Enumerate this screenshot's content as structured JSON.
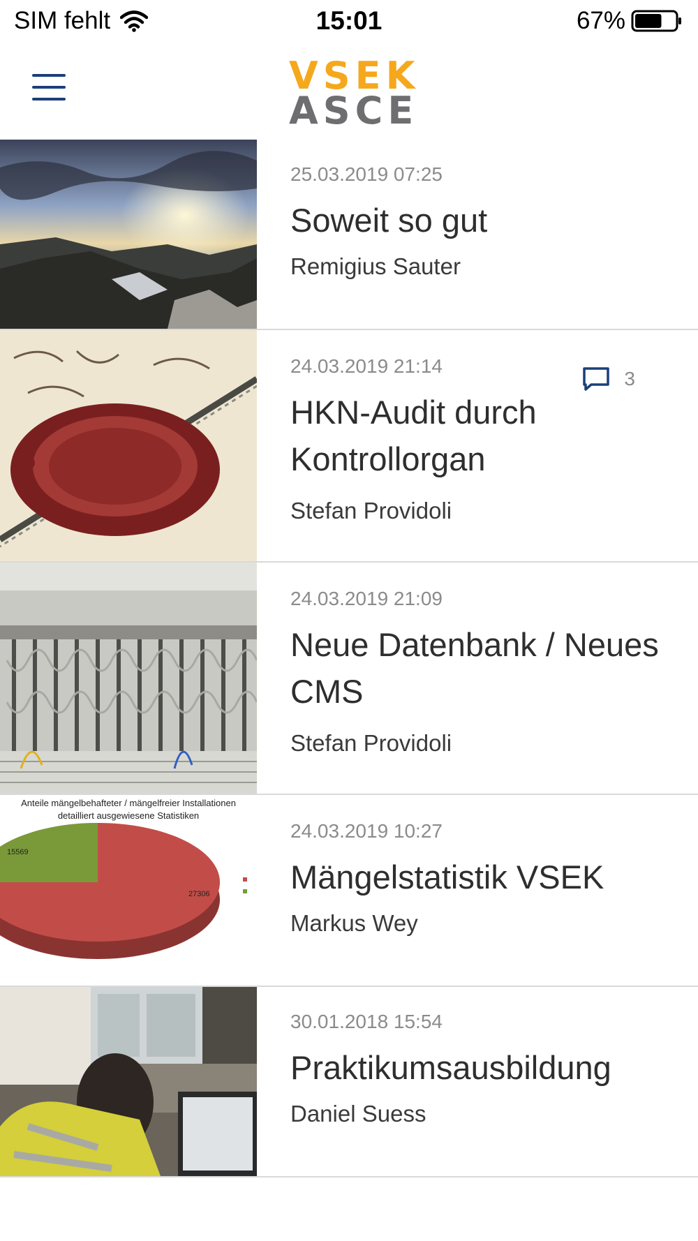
{
  "status_bar": {
    "carrier": "SIM fehlt",
    "time": "15:01",
    "battery_percent": "67%",
    "battery_level": 0.67,
    "wifi_icon": "wifi-icon",
    "battery_icon": "battery-icon"
  },
  "header": {
    "menu_icon": "hamburger-menu-icon",
    "logo_top": "VSEK",
    "logo_bottom": "ASCE",
    "logo_colors": {
      "top": "#f5a81c",
      "bottom": "#6e6e70"
    },
    "accent_color": "#1b3f7a"
  },
  "news": [
    {
      "date": "25.03.2019 07:25",
      "title": "Soweit so gut",
      "author": "Remigius Sauter",
      "comments": null,
      "image": "mountain-sunset-photo"
    },
    {
      "date": "24.03.2019 21:14",
      "title": "HKN-Audit durch Kontrollorgan",
      "author": "Stefan Providoli",
      "comments": "3",
      "image": "wax-seal-photo"
    },
    {
      "date": "24.03.2019 21:09",
      "title": "Neue Datenbank / Neues CMS",
      "author": "Stefan Providoli",
      "comments": null,
      "image": "electrical-wiring-photo"
    },
    {
      "date": "24.03.2019 10:27",
      "title": "Mängelstatistik VSEK",
      "author": "Markus Wey",
      "comments": null,
      "image": "pie-chart-image",
      "image_text": {
        "line1": "Anteile  mängelbehafteter / mängelfreier Installationen",
        "line2": "detailliert ausgewiesene Statistiken",
        "value_a": "15569",
        "value_b": "27306"
      }
    },
    {
      "date": "30.01.2018 15:54",
      "title": "Praktikumsausbildung",
      "author": "Daniel Suess",
      "comments": null,
      "image": "office-worker-photo"
    }
  ]
}
